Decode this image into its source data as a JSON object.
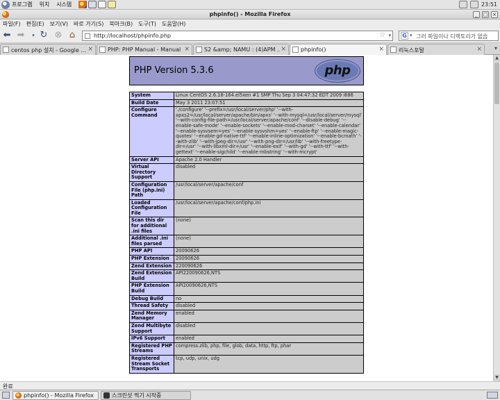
{
  "gnome_panel": {
    "menus": [
      "프로그램",
      "위치",
      "시스템"
    ],
    "clock": "23:51",
    "icons": [
      "gnome-foot-icon",
      "firefox-launcher-icon",
      "mail-launcher-icon",
      "editor-launcher-icon",
      "notes-launcher-icon",
      "network-tray-icon",
      "volume-tray-icon"
    ]
  },
  "window": {
    "title": "phpinfo() - Mozilla Firefox",
    "controls": [
      "minimize",
      "maximize",
      "close"
    ]
  },
  "menubar": [
    "파일(F)",
    "편집(E)",
    "보기(V)",
    "바로 가기(S)",
    "북마크(B)",
    "도구(T)",
    "도움말(H)"
  ],
  "navbar": {
    "url": "http://localhost/phpinfo.php",
    "search_placeholder": "그러 파일이나 디렉토리가 없습",
    "search_engine_icon": "G"
  },
  "tabs": [
    {
      "label": "centos php 설치 - Google ...",
      "active": false
    },
    {
      "label": "PHP: PHP Manual - Manual",
      "active": false
    },
    {
      "label": "S2 &amp; NAMU : (4)APM ...",
      "active": false
    },
    {
      "label": "phpinfo()",
      "active": true
    },
    {
      "label": "리눅스포탈",
      "active": false
    }
  ],
  "php": {
    "version_title": "PHP Version 5.3.6",
    "logo_text": "php",
    "rows": [
      {
        "key": "System",
        "value": "Linux CentOS 2.6.18-164.el5xen #1 SMP Thu Sep 3 04:47:32 EDT 2009 i686"
      },
      {
        "key": "Build Date",
        "value": "May 3 2011 23:07:51"
      },
      {
        "key": "Configure Command",
        "value": "'./configure' '--prefix=/usr/local/server/php' '--with-apxs2=/usr/local/server/apache/bin/apxs' '--with-mysql=/usr/local/server/mysql' '--with-config-file-path=/usr/local/server/apache/conf' '--disable-debug' '--enable-safe-mode' '--enable-sockets' '--enable-mod-charset' '--enable-calendar' '--enable-sysvsem=yes' '--enable-sysvshm=yes' '--enable-ftp' '--enable-magic-quotes' '--enable-gd-native-ttf' '--enable-inline-optimization' '--enable-bcmath' '--with-zlib' '--with-jpeg-dir=/usr' '--with-png-dir=/usr/lib' '--with-freetype-dir=/usr' '--with-libxml-dir=/usr' '--enable-exif' '--with-gd' '--with-ttf' '--with-gettext' '--enable-sigchild' '--enable-mbstring' '--with-mcrypt'"
      },
      {
        "key": "Server API",
        "value": "Apache 2.0 Handler"
      },
      {
        "key": "Virtual Directory Support",
        "value": "disabled"
      },
      {
        "key": "Configuration File (php.ini) Path",
        "value": "/usr/local/server/apache/conf"
      },
      {
        "key": "Loaded Configuration File",
        "value": "/usr/local/server/apache/conf/php.ini"
      },
      {
        "key": "Scan this dir for additional .ini files",
        "value": "(none)"
      },
      {
        "key": "Additional .ini files parsed",
        "value": "(none)"
      },
      {
        "key": "PHP API",
        "value": "20090626"
      },
      {
        "key": "PHP Extension",
        "value": "20090626"
      },
      {
        "key": "Zend Extension",
        "value": "220090626"
      },
      {
        "key": "Zend Extension Build",
        "value": "API220090626,NTS"
      },
      {
        "key": "PHP Extension Build",
        "value": "API20090626,NTS"
      },
      {
        "key": "Debug Build",
        "value": "no"
      },
      {
        "key": "Thread Safety",
        "value": "disabled"
      },
      {
        "key": "Zend Memory Manager",
        "value": "enabled"
      },
      {
        "key": "Zend Multibyte Support",
        "value": "disabled"
      },
      {
        "key": "IPv6 Support",
        "value": "enabled"
      },
      {
        "key": "Registered PHP Streams",
        "value": "compress.zlib, php, file, glob, data, http, ftp, phar"
      },
      {
        "key": "Registered Stream Socket Transports",
        "value": "tcp, udp, unix, udg"
      }
    ]
  },
  "statusbar": {
    "text": "완료"
  },
  "taskbar": {
    "items": [
      {
        "label": "phpinfo() - Mozilla Firefox",
        "active": true
      },
      {
        "label": "스크린샷 찍기 시작중",
        "active": false
      }
    ]
  },
  "colors": {
    "php_header": "#9999cc",
    "php_key_cell": "#ccccff",
    "php_value_cell": "#cccccc"
  }
}
